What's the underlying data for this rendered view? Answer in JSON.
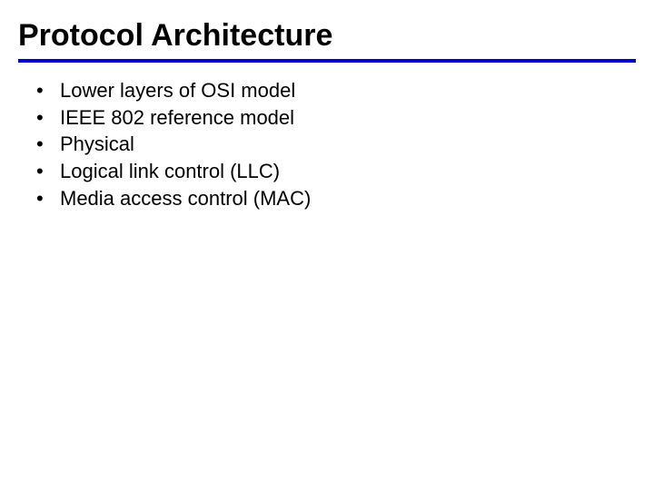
{
  "title": "Protocol Architecture",
  "bullets": [
    "Lower layers of OSI model",
    "IEEE 802 reference model",
    "Physical",
    "Logical link control (LLC)",
    "Media access control (MAC)"
  ]
}
